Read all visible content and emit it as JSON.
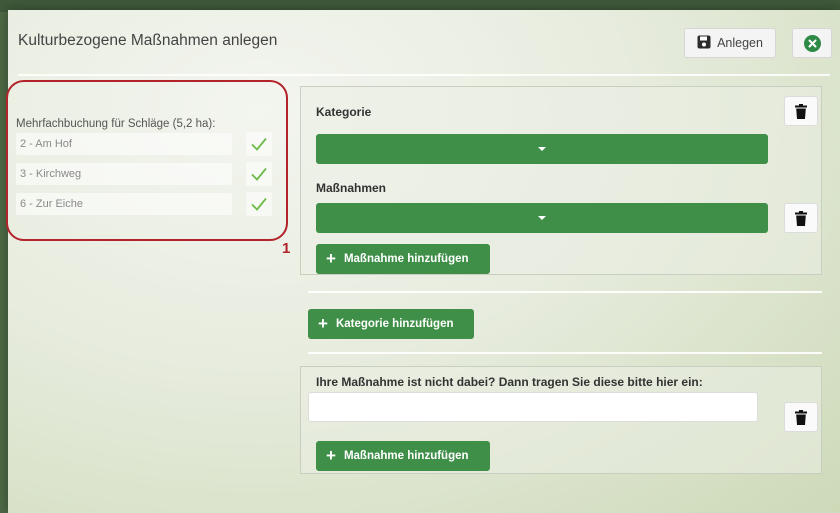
{
  "modal": {
    "title": "Kulturbezogene Maßnahmen anlegen",
    "save_label": "Anlegen"
  },
  "plots": {
    "heading": "Mehrfachbuchung für Schläge (5,2 ha):",
    "items": [
      {
        "label": "2 - Am Hof",
        "checked": true
      },
      {
        "label": "3 - Kirchweg",
        "checked": true
      },
      {
        "label": "6 - Zur Eiche",
        "checked": true
      }
    ],
    "marker": "1"
  },
  "category_card": {
    "category_label": "Kategorie",
    "category_value": "",
    "measures_label": "Maßnahmen",
    "measure_value": "",
    "add_measure_label": "Maßnahme hinzufügen"
  },
  "add_category_label": "Kategorie hinzufügen",
  "custom_card": {
    "prompt": "Ihre Maßnahme ist nicht dabei? Dann tragen Sie diese bitte hier ein:",
    "input_value": "",
    "add_measure_label": "Maßnahme hinzufügen"
  },
  "colors": {
    "accent_green": "#3f8f49",
    "highlight_red": "#b3232b"
  },
  "icons": [
    "save-icon",
    "close-icon",
    "trash-icon",
    "check-icon",
    "plus-icon",
    "caret-down-icon"
  ]
}
